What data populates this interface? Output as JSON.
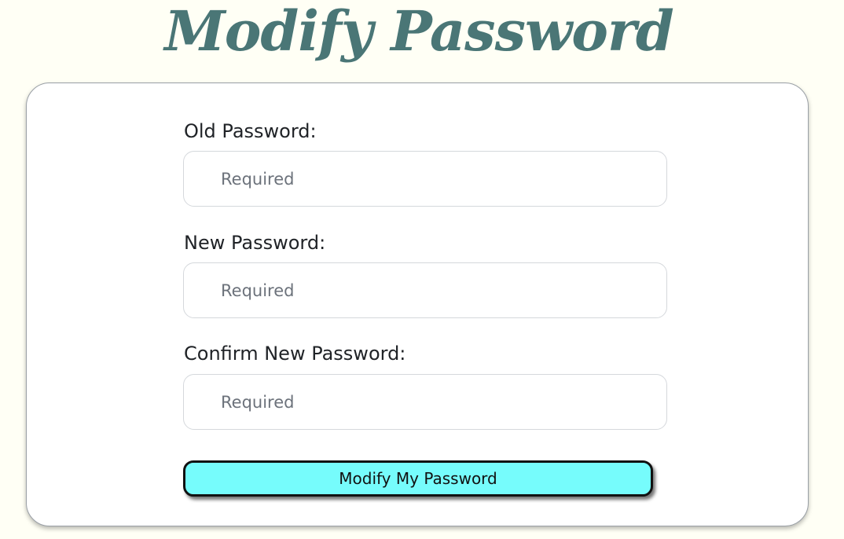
{
  "page": {
    "title": "Modify Password"
  },
  "form": {
    "fields": [
      {
        "label": "Old Password:",
        "placeholder": "Required",
        "value": ""
      },
      {
        "label": "New Password:",
        "placeholder": "Required",
        "value": ""
      },
      {
        "label": "Confirm New Password:",
        "placeholder": "Required",
        "value": ""
      }
    ],
    "submit_label": "Modify My Password"
  },
  "colors": {
    "background": "#fffff5",
    "title": "#4a7676",
    "card": "#ffffff",
    "label_text": "#202327",
    "placeholder_text": "#6c727b",
    "button_fill": "#76fcfc",
    "button_border": "#111111"
  }
}
